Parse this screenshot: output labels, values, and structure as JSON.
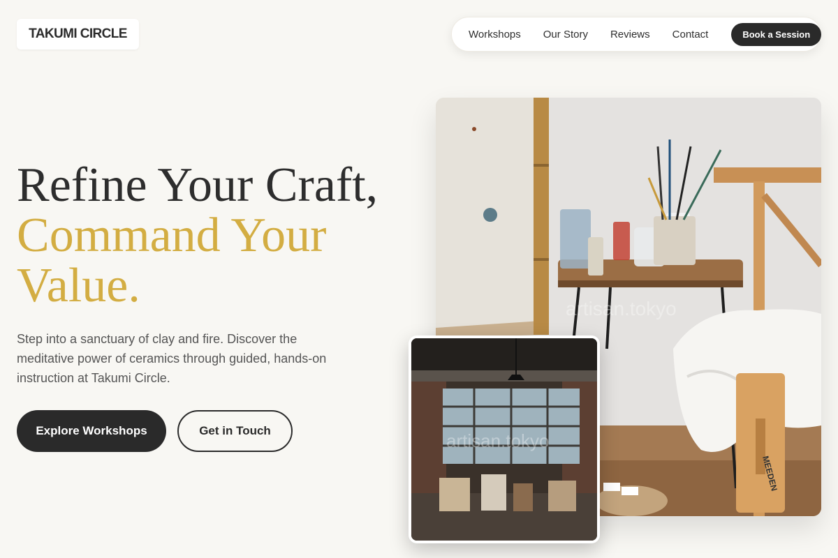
{
  "brand": {
    "logo_text": "TAKUMI CIRCLE"
  },
  "nav": {
    "links": [
      "Workshops",
      "Our Story",
      "Reviews",
      "Contact"
    ],
    "cta_label": "Book a Session"
  },
  "hero": {
    "headline_line1": "Refine Your Craft,",
    "headline_line2": "Command Your",
    "headline_line3": "Value.",
    "subtext": "Step into a sanctuary of clay and fire. Discover the meditative power of ceramics through guided, hands-on instruction at Takumi Circle.",
    "primary_button": "Explore Workshops",
    "secondary_button": "Get in Touch"
  },
  "images": {
    "main_watermark": "artisan.tokyo",
    "small_watermark": "artisan.tokyo",
    "stool_brand": "MEEDEN"
  },
  "colors": {
    "background": "#f8f7f3",
    "accent_gold": "#d3ad42",
    "dark": "#2a2a2a"
  }
}
